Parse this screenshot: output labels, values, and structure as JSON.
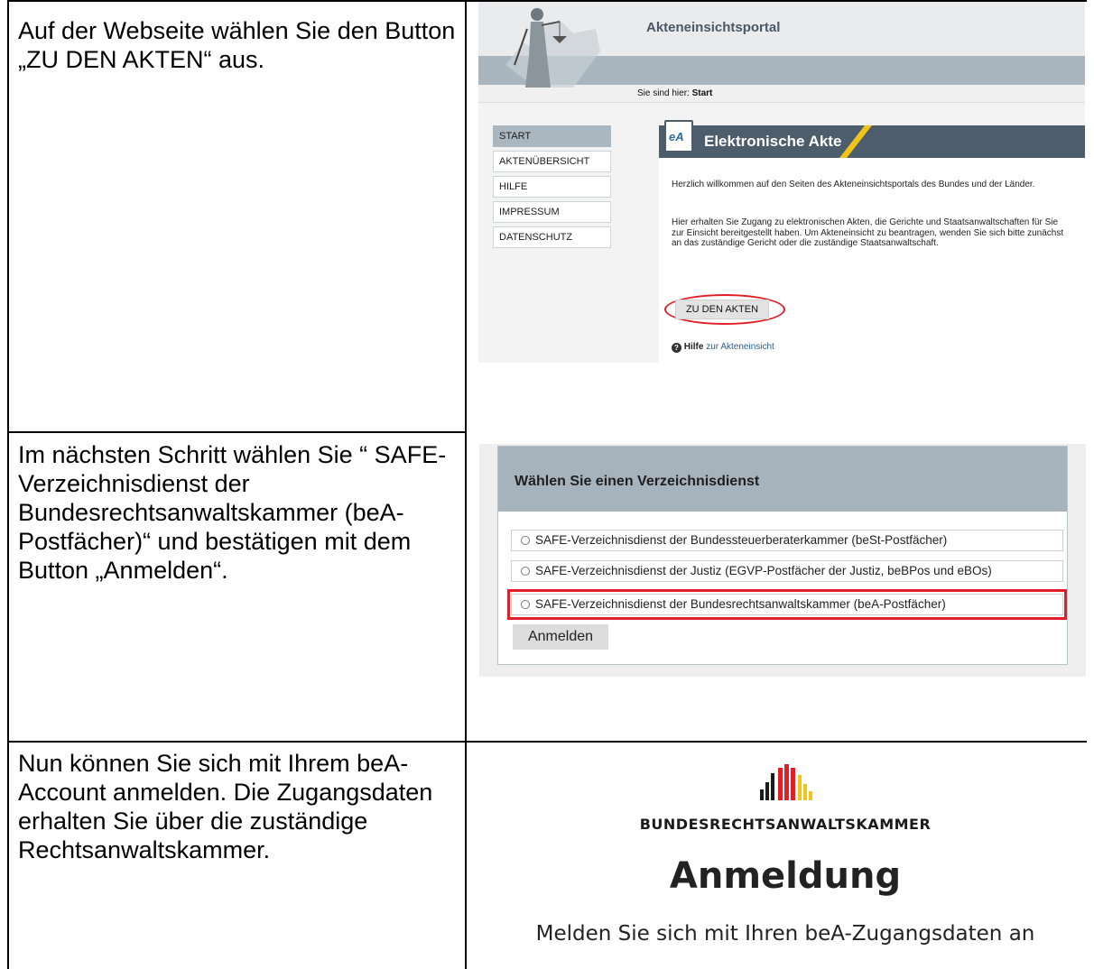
{
  "rows": [
    {
      "text": "Auf der Webseite wählen Sie den Button „ZU DEN AKTEN“ aus."
    },
    {
      "text": "Im nächsten Schritt wählen Sie “ SAFE-Verzeichnisdienst der Bundesrechtsanwaltskammer (beA-Postfächer)“ und bestätigen mit dem Button „Anmelden“."
    },
    {
      "text": "Nun können Sie sich mit Ihrem beA-Account anmelden. Die Zugangsdaten erhalten Sie über die zuständige Rechtsanwaltskammer."
    }
  ],
  "portal": {
    "title": "Akteneinsichtsportal",
    "breadcrumb_label": "Sie sind hier:",
    "breadcrumb_current": "Start",
    "menu": [
      "START",
      "AKTENÜBERSICHT",
      "HILFE",
      "IMPRESSUM",
      "DATENSCHUTZ"
    ],
    "panel_icon": "eA",
    "panel_title": "Elektronische Akte",
    "welcome": "Herzlich willkommen auf den Seiten des Akteneinsichtsportals des Bundes und der Länder.",
    "info": "Hier erhalten Sie Zugang zu elektronischen Akten, die Gerichte und Staatsanwaltschaften für Sie zur Einsicht bereitgestellt haben. Um Akteneinsicht zu beantragen, wenden Sie sich bitte zunächst an das zuständige Gericht oder die zuständige Staatsanwaltschaft.",
    "button": "ZU DEN AKTEN",
    "help_strong": "Hilfe",
    "help_rest": " zur Akteneinsicht",
    "colors": {
      "header_band": "#a9b6bf",
      "panel_head": "#4d5d6b",
      "accent_yellow": "#f0c419",
      "highlight": "#e21f26"
    }
  },
  "directory": {
    "title": "Wählen Sie einen Verzeichnisdienst",
    "options": [
      "SAFE-Verzeichnisdienst der Bundessteuerberaterkammer (beSt-Postfächer)",
      "SAFE-Verzeichnisdienst der Justiz (EGVP-Postfächer der Justiz, beBPos und eBOs)",
      "SAFE-Verzeichnisdienst der Bundesrechtsanwaltskammer (beA-Postfächer)"
    ],
    "button": "Anmelden"
  },
  "login": {
    "org": "BUNDESRECHTSANWALTSKAMMER",
    "title": "Anmeldung",
    "subtitle": "Melden Sie sich mit Ihren beA-Zugangsdaten an",
    "logo_colors": [
      "#1b1b1b",
      "#e21f26",
      "#f0c419"
    ]
  }
}
